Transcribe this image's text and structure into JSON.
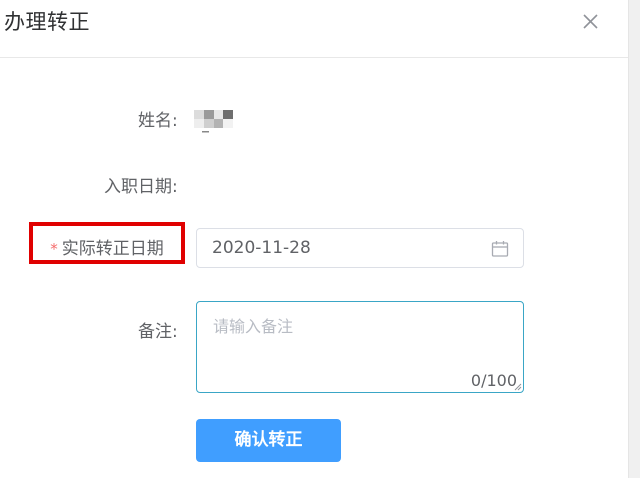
{
  "dialog": {
    "title": "办理转正",
    "close_icon": "close-icon"
  },
  "form": {
    "name_label": "姓名:",
    "hire_date_label": "入职日期:",
    "required_star": "*",
    "actual_date_label": "实际转正日期",
    "actual_date_value": "2020-11-28",
    "calendar_icon": "calendar-icon",
    "note_label": "备注:",
    "note_placeholder": "请输入备注",
    "note_count": "0/100",
    "confirm_label": "确认转正"
  },
  "colors": {
    "primary": "#409eff",
    "highlight_box": "#e00000",
    "required": "#f56c6c",
    "focus_border": "#3aa6c6"
  }
}
